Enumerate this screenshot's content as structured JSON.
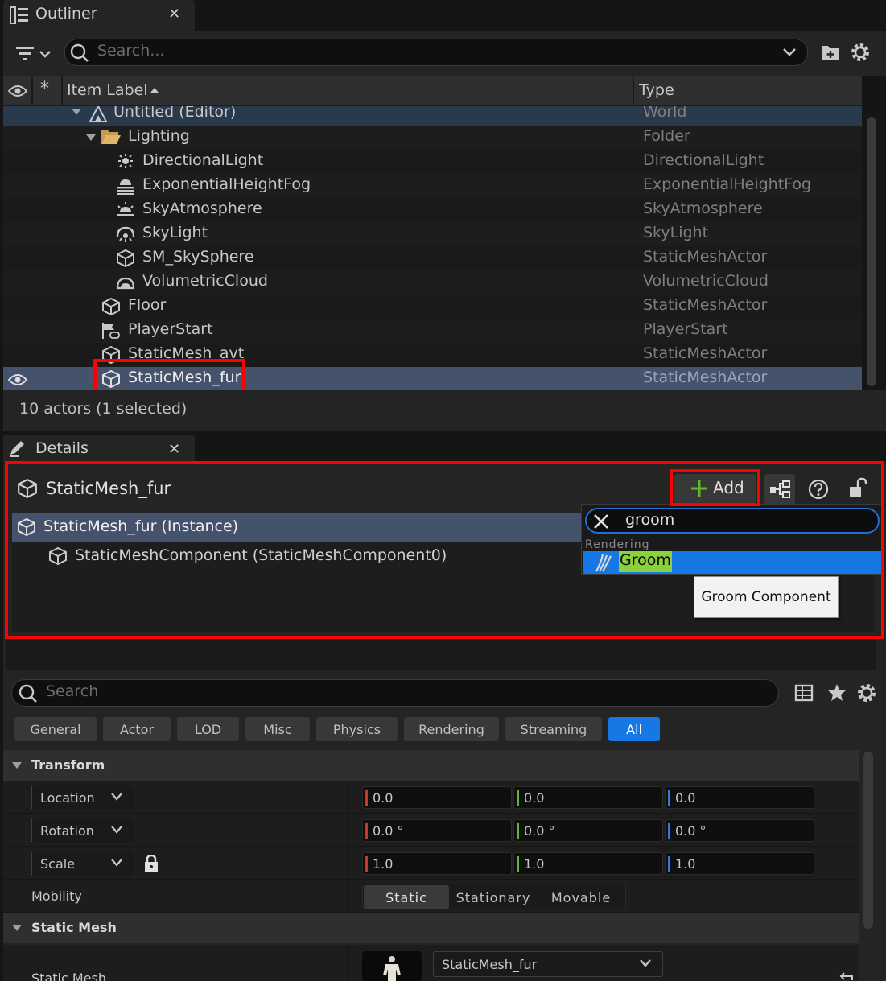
{
  "outliner": {
    "tab_title": "Outliner",
    "search_placeholder": "Search...",
    "columns": {
      "label": "Item Label",
      "type": "Type"
    },
    "rows": [
      {
        "label": "Untitled (Editor)",
        "type": "World"
      },
      {
        "label": "Lighting",
        "type": "Folder"
      },
      {
        "label": "DirectionalLight",
        "type": "DirectionalLight"
      },
      {
        "label": "ExponentialHeightFog",
        "type": "ExponentialHeightFog"
      },
      {
        "label": "SkyAtmosphere",
        "type": "SkyAtmosphere"
      },
      {
        "label": "SkyLight",
        "type": "SkyLight"
      },
      {
        "label": "SM_SkySphere",
        "type": "StaticMeshActor"
      },
      {
        "label": "VolumetricCloud",
        "type": "VolumetricCloud"
      },
      {
        "label": "Floor",
        "type": "StaticMeshActor"
      },
      {
        "label": "PlayerStart",
        "type": "PlayerStart"
      },
      {
        "label": "StaticMesh_avt",
        "type": "StaticMeshActor"
      },
      {
        "label": "StaticMesh_fur",
        "type": "StaticMeshActor"
      }
    ],
    "footer": "10 actors (1 selected)"
  },
  "details": {
    "tab_title": "Details",
    "actor_name": "StaticMesh_fur",
    "add_label": "Add",
    "instance_row": "StaticMesh_fur (Instance)",
    "component_row": "StaticMeshComponent (StaticMeshComponent0)",
    "add_dropdown": {
      "search_value": "groom",
      "category": "Rendering",
      "item": "Groom",
      "tooltip": "Groom Component"
    },
    "search_placeholder": "Search",
    "categories": [
      "General",
      "Actor",
      "LOD",
      "Misc",
      "Physics",
      "Rendering",
      "Streaming",
      "All"
    ],
    "active_category": "All",
    "sections": {
      "transform": "Transform",
      "static_mesh": "Static Mesh"
    },
    "transform": {
      "location": {
        "label": "Location",
        "x": "0.0",
        "y": "0.0",
        "z": "0.0"
      },
      "rotation": {
        "label": "Rotation",
        "x": "0.0 °",
        "y": "0.0 °",
        "z": "0.0 °"
      },
      "scale": {
        "label": "Scale",
        "x": "1.0",
        "y": "1.0",
        "z": "1.0"
      }
    },
    "mobility": {
      "label": "Mobility",
      "options": [
        "Static",
        "Stationary",
        "Movable"
      ],
      "selected": "Static"
    },
    "static_mesh": {
      "label": "Static Mesh",
      "value": "StaticMesh_fur"
    }
  },
  "colors": {
    "accent": "#1678e5",
    "highlight": "#ff0000",
    "axis_x": "#c83a1e",
    "axis_y": "#5fb82a",
    "axis_z": "#2f7de0"
  }
}
